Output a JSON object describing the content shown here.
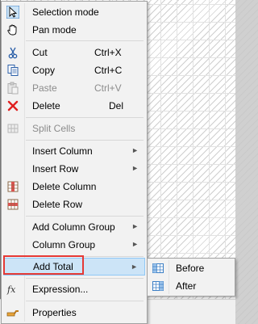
{
  "menu": {
    "items": [
      {
        "label": "Selection mode",
        "icon": "cursor-arrow-icon"
      },
      {
        "label": "Pan mode",
        "icon": "hand-icon"
      },
      {
        "label": "Cut",
        "shortcut": "Ctrl+X",
        "icon": "scissors-icon"
      },
      {
        "label": "Copy",
        "shortcut": "Ctrl+C",
        "icon": "copy-icon"
      },
      {
        "label": "Paste",
        "shortcut": "Ctrl+V",
        "icon": "paste-icon",
        "disabled": true
      },
      {
        "label": "Delete",
        "shortcut": "Del",
        "icon": "red-x-icon"
      },
      {
        "label": "Split Cells",
        "icon": "split-cells-icon",
        "disabled": true
      },
      {
        "label": "Insert Column",
        "submenu": true
      },
      {
        "label": "Insert Row",
        "submenu": true
      },
      {
        "label": "Delete Column",
        "icon": "delete-column-icon"
      },
      {
        "label": "Delete Row",
        "icon": "delete-row-icon"
      },
      {
        "label": "Add Column Group",
        "submenu": true
      },
      {
        "label": "Column Group",
        "submenu": true
      },
      {
        "label": "Add Total",
        "submenu": true,
        "highlighted": true
      },
      {
        "label": "Expression...",
        "icon": "fx-icon"
      },
      {
        "label": "Properties",
        "icon": "properties-icon"
      }
    ],
    "submenu_arrow": "►"
  },
  "submenu": {
    "items": [
      {
        "label": "Before",
        "icon": "total-before-icon"
      },
      {
        "label": "After",
        "icon": "total-after-icon"
      }
    ]
  },
  "colors": {
    "highlight": "#cce4f7",
    "annotation": "#e53935"
  }
}
